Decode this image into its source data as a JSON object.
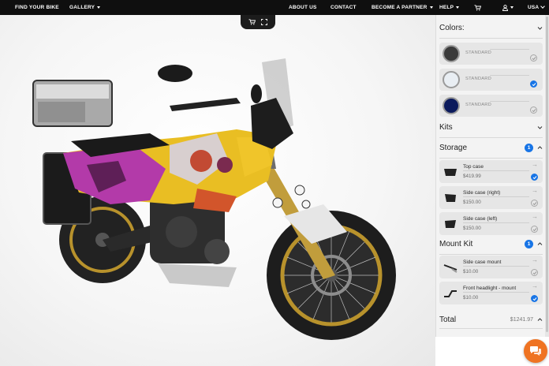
{
  "nav": {
    "find_your_bike": "FIND YOUR BIKE",
    "gallery": "GALLERY",
    "about_us": "ABOUT US",
    "contact": "CONTACT",
    "become_partner": "BECOME A PARTNER",
    "help": "HELP",
    "country": "USA"
  },
  "config": {
    "colors": {
      "title": "Colors:",
      "items": [
        {
          "label": "STANDARD",
          "color": "#3a3a3a",
          "selected": false
        },
        {
          "label": "STANDARD",
          "color": "#e9eef3",
          "selected": true
        },
        {
          "label": "STANDARD",
          "color": "#0b1a5c",
          "selected": false
        }
      ]
    },
    "kits": {
      "title": "Kits"
    },
    "storage": {
      "title": "Storage",
      "count": "1",
      "items": [
        {
          "name": "Top case",
          "price": "$419.99",
          "selected": true
        },
        {
          "name": "Side case (right)",
          "price": "$150.00",
          "selected": false
        },
        {
          "name": "Side case (left)",
          "price": "$150.00",
          "selected": false
        }
      ]
    },
    "mount_kit": {
      "title": "Mount Kit",
      "count": "1",
      "items": [
        {
          "name": "Side case mount",
          "price": "$10.00",
          "selected": false
        },
        {
          "name": "Front headlight - mount",
          "price": "$10.00",
          "selected": true
        }
      ]
    },
    "total": {
      "label": "Total",
      "value": "$1241.97"
    }
  },
  "colors": {
    "accent": "#1875e6",
    "nav_bg": "#0f0f0f",
    "chat": "#ef7322"
  },
  "icons": [
    "cart-icon",
    "user-icon",
    "chevron-down-icon",
    "fullscreen-icon",
    "arrow-right-icon",
    "check-icon",
    "chat-icon"
  ]
}
